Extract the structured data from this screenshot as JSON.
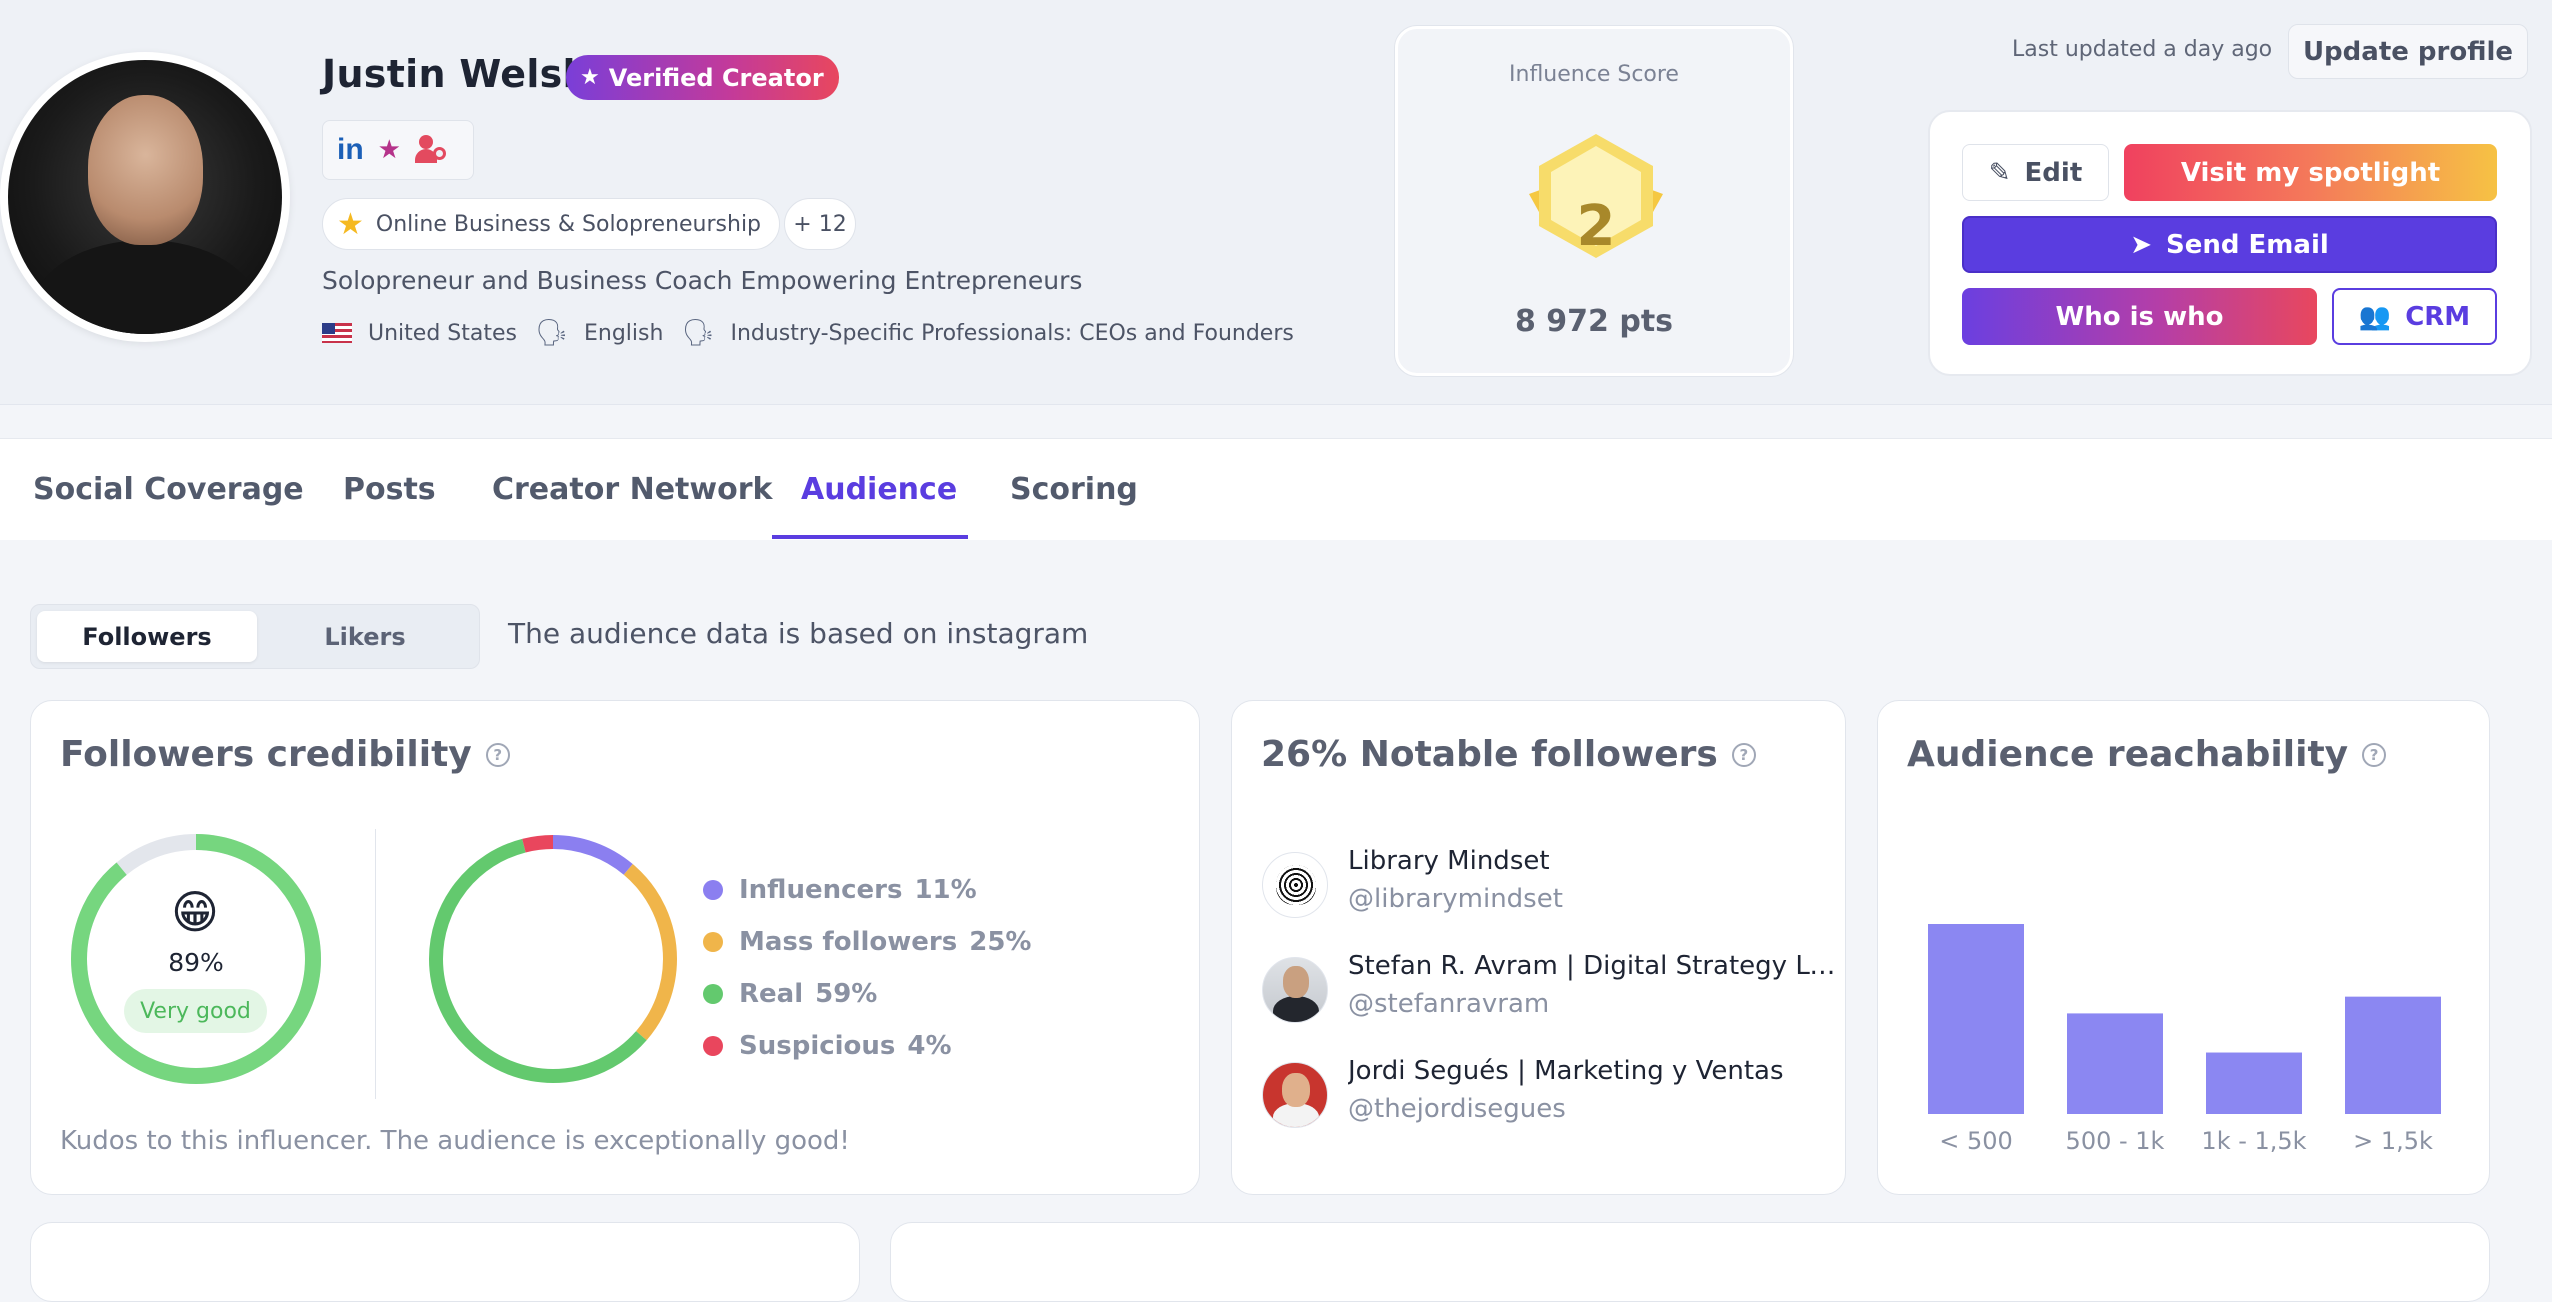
{
  "profile": {
    "name": "Justin Welsh",
    "verified_label": "Verified Creator",
    "category": "Online Business & Solopreneurship",
    "more_categories": "+ 12",
    "bio": "Solopreneur and Business Coach Empowering Entrepreneurs",
    "country": "United States",
    "language": "English",
    "audience_type": "Industry-Specific Professionals: CEOs and Founders",
    "social_icons": [
      "linkedin-icon",
      "star-icon",
      "user-search-icon"
    ]
  },
  "score": {
    "title": "Influence Score",
    "rank": "2",
    "points": "8 972 pts"
  },
  "header_actions": {
    "last_updated": "Last updated a day ago",
    "update_profile": "Update profile",
    "edit": "Edit",
    "visit_spotlight": "Visit my spotlight",
    "send_email": "Send Email",
    "who_is_who": "Who is who",
    "crm": "CRM"
  },
  "tabs": [
    {
      "label": "Social Coverage",
      "active": false
    },
    {
      "label": "Posts",
      "active": false
    },
    {
      "label": "Creator Network",
      "active": false
    },
    {
      "label": "Audience",
      "active": true
    },
    {
      "label": "Scoring",
      "active": false
    }
  ],
  "audience": {
    "toggle": [
      "Followers",
      "Likers"
    ],
    "active_toggle": "Followers",
    "source_note": "The audience data is based on instagram"
  },
  "credibility": {
    "title": "Followers credibility",
    "score_pct": "89%",
    "rating": "Very good",
    "score_fraction": 0.89,
    "emoji": "😁",
    "message": "Kudos to this influencer. The audience is exceptionally good!",
    "breakdown": [
      {
        "label": "Influencers",
        "value": "11%",
        "color": "#8b7ff0",
        "pct": 11
      },
      {
        "label": "Mass followers",
        "value": "25%",
        "color": "#f0b54a",
        "pct": 25
      },
      {
        "label": "Real",
        "value": "59%",
        "color": "#63c96e",
        "pct": 59
      },
      {
        "label": "Suspicious",
        "value": "4%",
        "color": "#e9465d",
        "pct": 4
      }
    ]
  },
  "notable": {
    "title": "26% Notable followers",
    "items": [
      {
        "name": "Library Mindset",
        "handle": "@librarymindset"
      },
      {
        "name": "Stefan R. Avram | Digital Strategy Le...",
        "handle": "@stefanravram"
      },
      {
        "name": "Jordi Segués | Marketing y Ventas",
        "handle": "@thejordisegues"
      }
    ]
  },
  "reachability": {
    "title": "Audience reachability"
  },
  "chart_data": {
    "type": "bar",
    "categories": [
      "< 500",
      "500 - 1k",
      "1k - 1,5k",
      "> 1,5k"
    ],
    "values": [
      34,
      18,
      11,
      21
    ],
    "ylim": [
      0,
      40
    ],
    "grid": false,
    "color": "#8b87f2"
  }
}
